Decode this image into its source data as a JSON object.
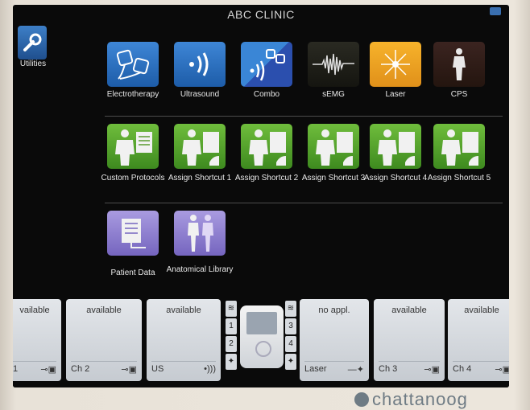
{
  "header": {
    "title": "ABC CLINIC"
  },
  "sidebar": {
    "utilities_label": "Utilities"
  },
  "modalities": [
    {
      "label": "Electrotherapy",
      "icon": "electrotherapy-electrodes-icon"
    },
    {
      "label": "Ultrasound",
      "icon": "ultrasound-waves-icon"
    },
    {
      "label": "Combo",
      "icon": "combo-icon"
    },
    {
      "label": "sEMG",
      "icon": "semg-waveform-icon"
    },
    {
      "label": "Laser",
      "icon": "laser-burst-icon"
    },
    {
      "label": "CPS",
      "icon": "cps-body-icon"
    }
  ],
  "protocols": [
    {
      "label": "Custom Protocols"
    },
    {
      "label": "Assign Shortcut 1"
    },
    {
      "label": "Assign Shortcut 2"
    },
    {
      "label": "Assign Shortcut 3"
    },
    {
      "label": "Assign Shortcut 4"
    },
    {
      "label": "Assign Shortcut 5"
    }
  ],
  "library": [
    {
      "label": "Patient Data"
    },
    {
      "label": "Anatomical Library"
    }
  ],
  "channels": [
    {
      "status": "vailable",
      "name": "1"
    },
    {
      "status": "available",
      "name": "Ch 2"
    },
    {
      "status": "available",
      "name": "US"
    },
    {
      "status": "no appl.",
      "name": "Laser"
    },
    {
      "status": "available",
      "name": "Ch 3"
    },
    {
      "status": "available",
      "name": "Ch 4"
    }
  ],
  "device_numbers": [
    "1",
    "2",
    "3",
    "4"
  ],
  "brand": "chattanoog",
  "colors": {
    "background": "#0a0a0a",
    "modality_blue": "#3e86d6",
    "laser_orange": "#f7b32b",
    "protocol_green": "#6fbd3c",
    "library_purple": "#a99be0"
  }
}
